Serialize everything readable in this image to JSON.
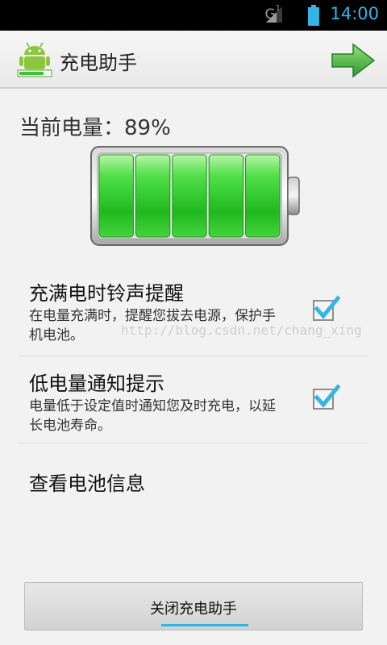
{
  "status_bar": {
    "network": "G",
    "network_sup": "1",
    "time": "14:00",
    "signal_icon": "signal-icon",
    "battery_icon": "battery-icon",
    "accent_color": "#33b5e5"
  },
  "action_bar": {
    "title": "充电助手",
    "app_icon": "android-robot-icon",
    "next_icon": "green-arrow-right-icon"
  },
  "battery": {
    "label": "当前电量：89%",
    "level_percent": 89,
    "segments_filled": 5,
    "fill_color": "#2ecc2e"
  },
  "preferences": [
    {
      "title": "充满电时铃声提醒",
      "summary": "在电量充满时，提醒您拔去电源，保护手机电池。",
      "checked": true
    },
    {
      "title": "低电量通知提示",
      "summary": "电量低于设定值时通知您及时充电，以延长电池寿命。",
      "checked": true
    }
  ],
  "watermark": "http://blog.csdn.net/chang_xing",
  "battery_info_label": "查看电池信息",
  "close_button_label": "关闭充电助手"
}
